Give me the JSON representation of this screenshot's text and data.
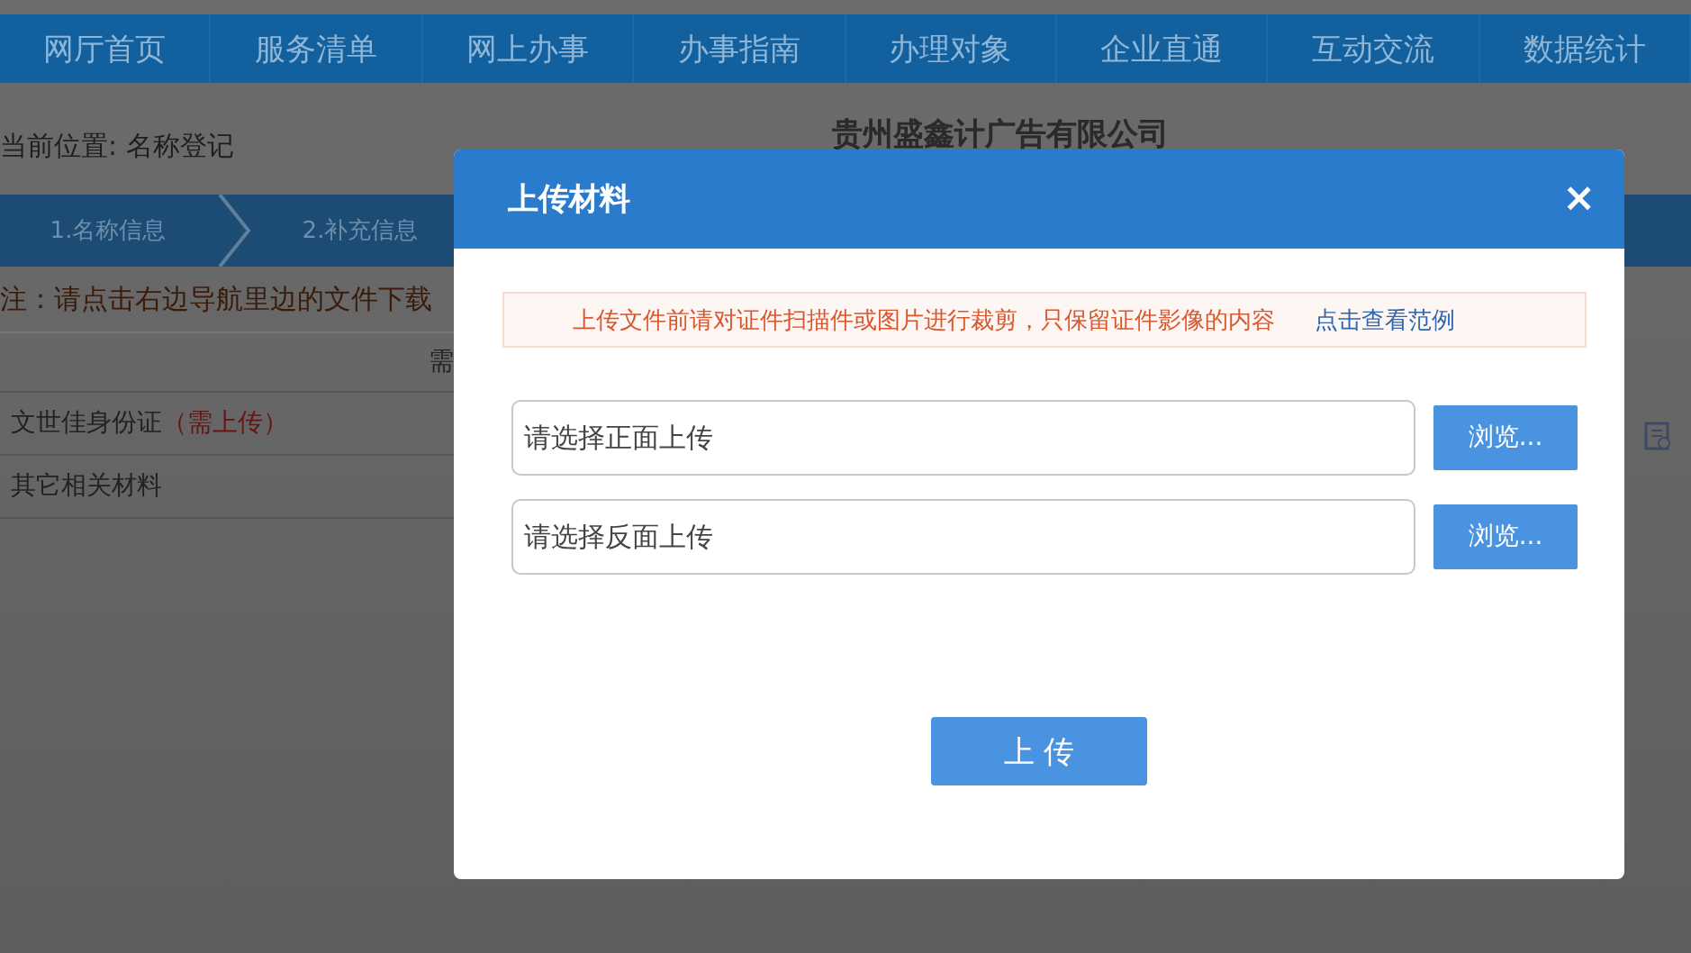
{
  "nav": [
    {
      "label": "网厅首页"
    },
    {
      "label": "服务清单"
    },
    {
      "label": "网上办事"
    },
    {
      "label": "办事指南"
    },
    {
      "label": "办理对象"
    },
    {
      "label": "企业直通"
    },
    {
      "label": "互动交流"
    },
    {
      "label": "数据统计"
    }
  ],
  "breadcrumb": "当前位置: 名称登记",
  "company_title": "贵州盛鑫计广告有限公司",
  "steps": [
    {
      "label": "1.名称信息"
    },
    {
      "label": "2.补充信息"
    }
  ],
  "note": "注：请点击右边导航里边的文件下载",
  "table": {
    "header": "需",
    "rows": [
      {
        "name": "文世佳身份证",
        "tag": "（需上传）"
      },
      {
        "name": "其它相关材料"
      }
    ]
  },
  "modal": {
    "title": "上传材料",
    "close": "×",
    "notice": "上传文件前请对证件扫描件或图片进行裁剪，只保留证件影像的内容",
    "notice_link": "点击查看范例",
    "fields": [
      {
        "placeholder": "请选择正面上传",
        "button": "浏览..."
      },
      {
        "placeholder": "请选择反面上传",
        "button": "浏览..."
      }
    ],
    "submit": "上 传"
  }
}
